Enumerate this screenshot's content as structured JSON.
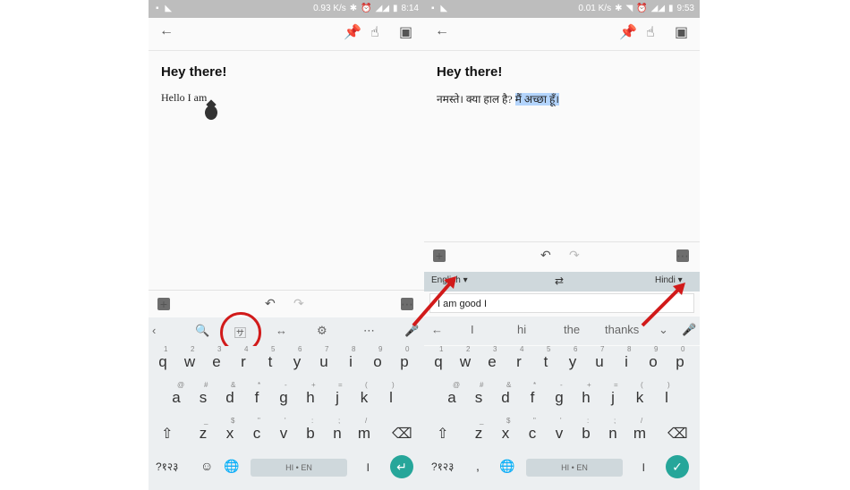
{
  "left": {
    "status": {
      "speed": "0.93 K/s",
      "time": "8:14"
    },
    "note": {
      "title": "Hey there!",
      "body": "Hello I am"
    },
    "space_label": "HI • EN",
    "symbols_label": "?१२३",
    "keys_row1": [
      "q",
      "w",
      "e",
      "r",
      "t",
      "y",
      "u",
      "i",
      "o",
      "p"
    ],
    "keys_row2": [
      "a",
      "s",
      "d",
      "f",
      "g",
      "h",
      "j",
      "k",
      "l"
    ],
    "keys_row3": [
      "z",
      "x",
      "c",
      "v",
      "b",
      "n",
      "m"
    ],
    "row1_hints": [
      "1",
      "2",
      "3",
      "4",
      "5",
      "6",
      "7",
      "8",
      "9",
      "0"
    ],
    "row2_hints": [
      "@",
      "#",
      "&",
      "*",
      "-",
      "+",
      "=",
      "(",
      ")"
    ],
    "row3_hints": [
      "_",
      "$",
      "\"",
      "'",
      ":",
      ";",
      "/"
    ]
  },
  "right": {
    "status": {
      "speed": "0.01 K/s",
      "time": "9:53"
    },
    "note": {
      "title": "Hey there!",
      "body_prefix": "नमस्ते। क्या हाल है? ",
      "body_selected": "मैं अच्छा हूँ।"
    },
    "translate": {
      "source": "English",
      "target": "Hindi",
      "input": "I am good I"
    },
    "suggestions": [
      "I",
      "hi",
      "the",
      "thanks"
    ],
    "space_label": "HI • EN",
    "symbols_label": "?१२३"
  },
  "colors": {
    "accent": "#26a69a",
    "highlight": "#d11a1a",
    "selection": "#b3d4fc"
  }
}
